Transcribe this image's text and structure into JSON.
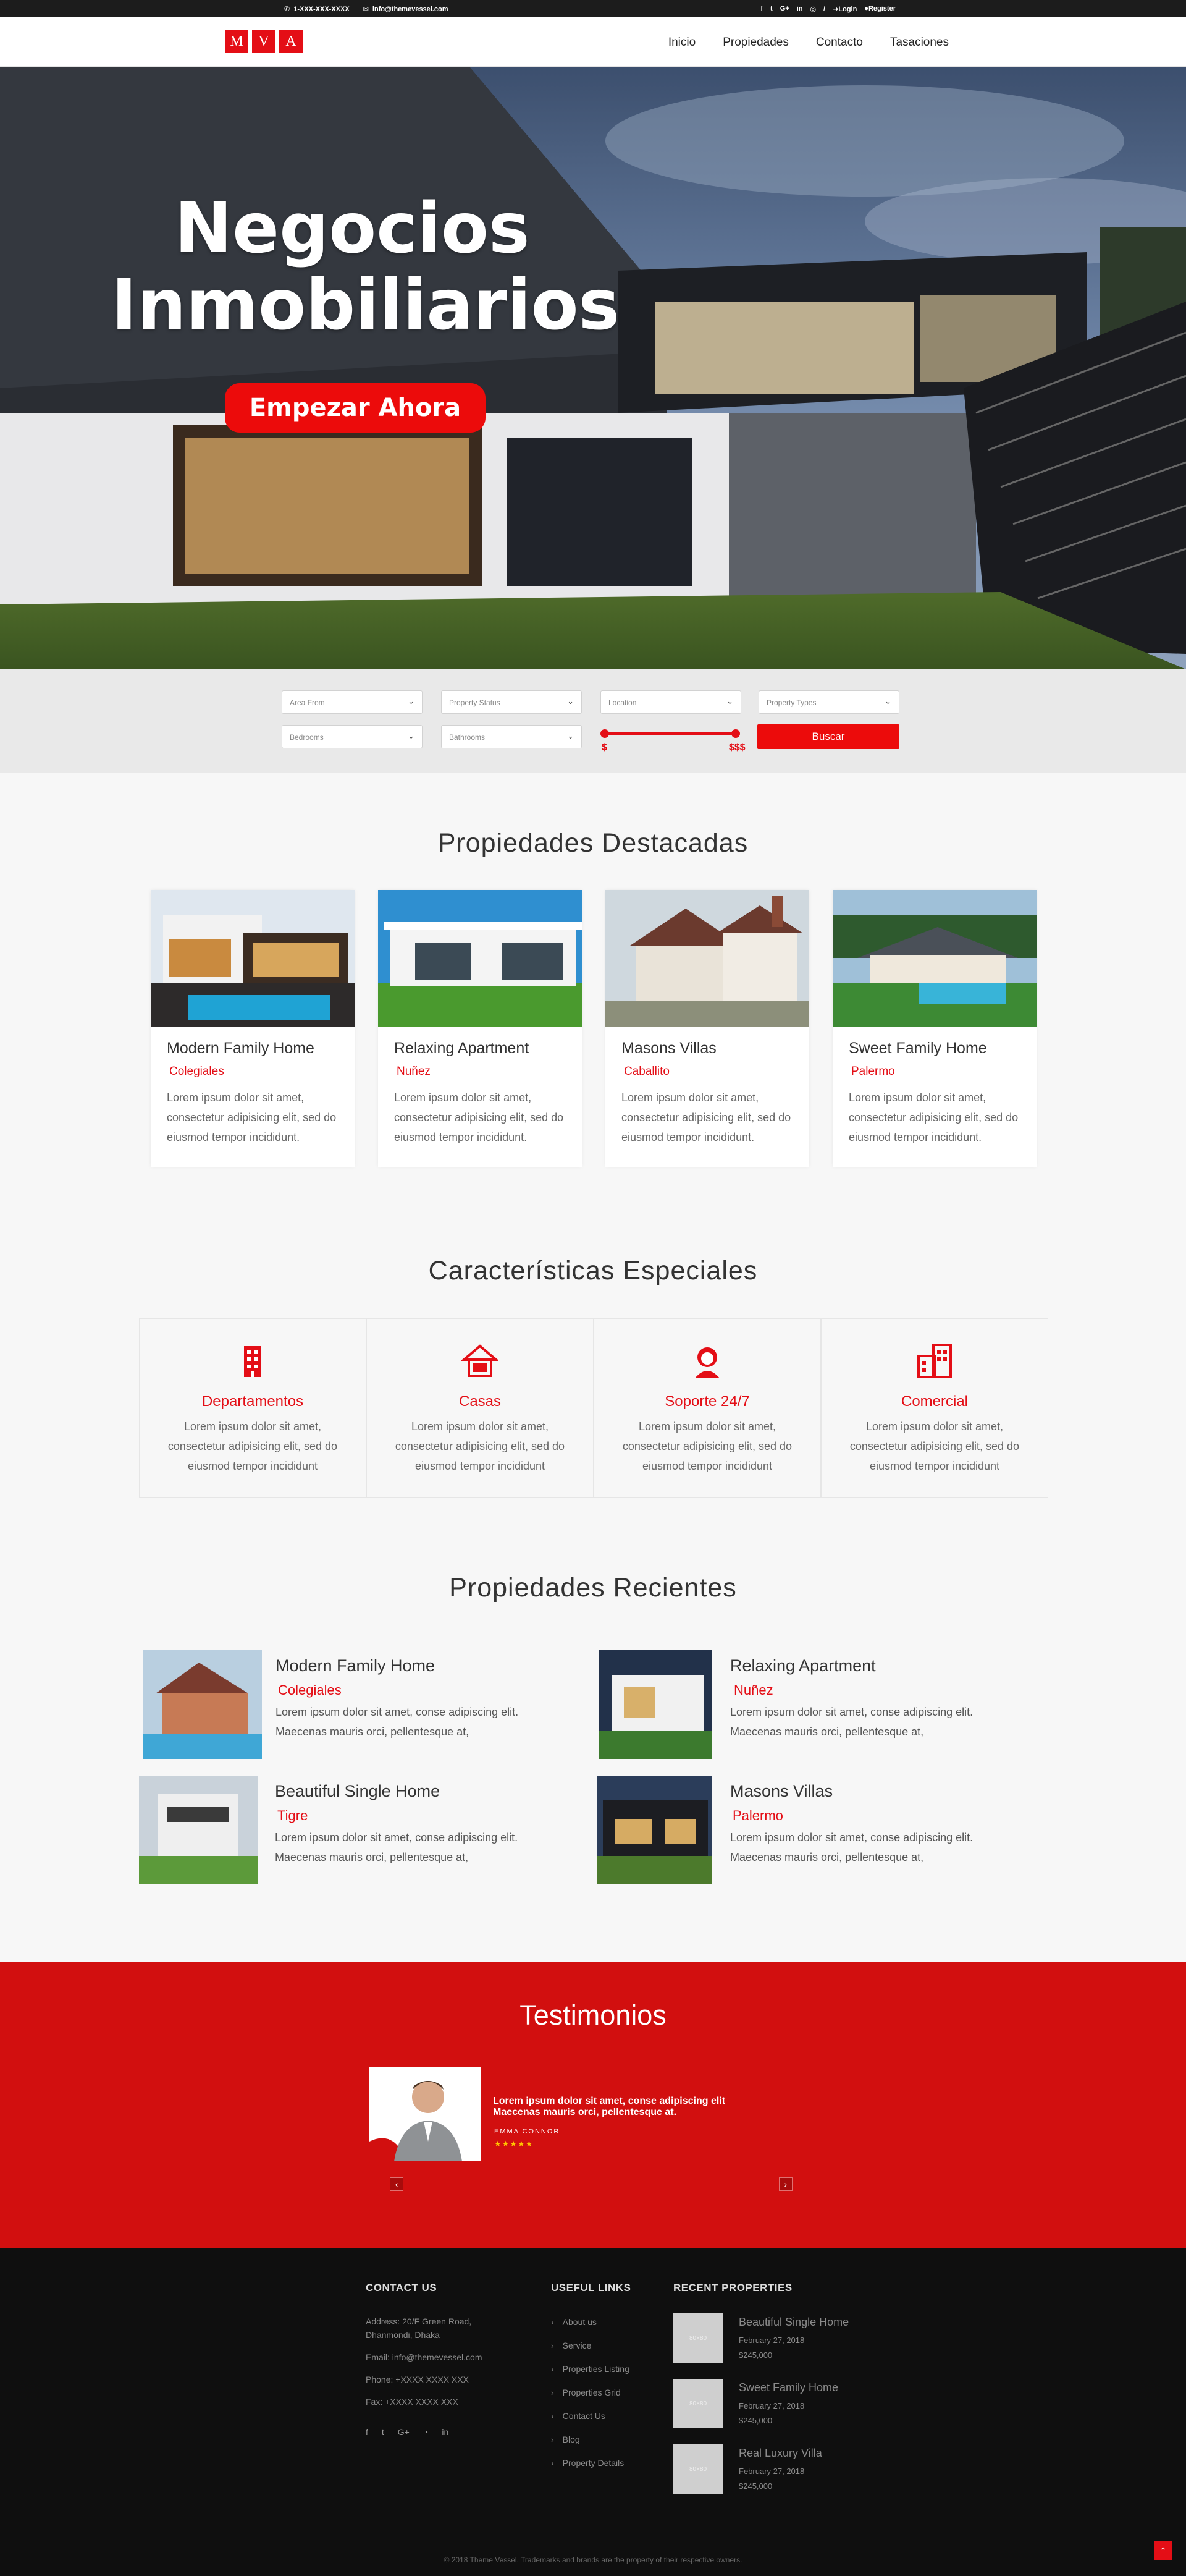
{
  "topbar": {
    "phone": "1-XXX-XXX-XXXX",
    "email": "info@themevessel.com",
    "social_icons": [
      "facebook-icon",
      "twitter-icon",
      "google-plus-icon",
      "linkedin-icon",
      "instagram-icon"
    ],
    "separator": "/",
    "login": "Login",
    "register": "Register"
  },
  "logo": {
    "letters": [
      "M",
      "V",
      "A"
    ]
  },
  "nav": {
    "items": [
      "Inicio",
      "Propiedades",
      "Contacto",
      "Tasaciones"
    ]
  },
  "hero": {
    "title_line1": "Negocios",
    "title_line2": "Inmobiliarios",
    "cta": "Empezar Ahora"
  },
  "search": {
    "area_from": "Area From",
    "property_status": "Property Status",
    "location": "Location",
    "property_types": "Property Types",
    "bedrooms": "Bedrooms",
    "bathrooms": "Bathrooms",
    "price_min_label": "$",
    "price_max_label": "$$$",
    "button": "Buscar"
  },
  "featured": {
    "title": "Propiedades Destacadas",
    "items": [
      {
        "title": "Modern Family Home",
        "location": "Colegiales",
        "desc": "Lorem ipsum dolor sit amet, consectetur adipisicing elit, sed do eiusmod tempor incididunt."
      },
      {
        "title": "Relaxing Apartment",
        "location": "Nuñez",
        "desc": "Lorem ipsum dolor sit amet, consectetur adipisicing elit, sed do eiusmod tempor incididunt."
      },
      {
        "title": "Masons Villas",
        "location": "Caballito",
        "desc": "Lorem ipsum dolor sit amet, consectetur adipisicing elit, sed do eiusmod tempor incididunt."
      },
      {
        "title": "Sweet Family Home",
        "location": "Palermo",
        "desc": "Lorem ipsum dolor sit amet, consectetur adipisicing elit, sed do eiusmod tempor incididunt."
      }
    ]
  },
  "features": {
    "title": "Características Especiales",
    "items": [
      {
        "icon": "building-icon",
        "title": "Departamentos",
        "desc": "Lorem ipsum dolor sit amet, consectetur adipisicing elit, sed do eiusmod tempor incididunt"
      },
      {
        "icon": "house-icon",
        "title": "Casas",
        "desc": "Lorem ipsum dolor sit amet, consectetur adipisicing elit, sed do eiusmod tempor incididunt"
      },
      {
        "icon": "support-agent-icon",
        "title": "Soporte 24/7",
        "desc": "Lorem ipsum dolor sit amet, consectetur adipisicing elit, sed do eiusmod tempor incididunt"
      },
      {
        "icon": "office-building-icon",
        "title": "Comercial",
        "desc": "Lorem ipsum dolor sit amet, consectetur adipisicing elit, sed do eiusmod tempor incididunt"
      }
    ]
  },
  "recent": {
    "title": "Propiedades Recientes",
    "items": [
      {
        "title": "Modern Family Home",
        "location": "Colegiales",
        "desc": "Lorem ipsum dolor sit amet, conse adipiscing elit. Maecenas mauris orci, pellentesque at,"
      },
      {
        "title": "Relaxing Apartment",
        "location": "Nuñez",
        "desc": "Lorem ipsum dolor sit amet, conse adipiscing elit. Maecenas mauris orci, pellentesque at,"
      },
      {
        "title": "Beautiful Single Home",
        "location": "Tigre",
        "desc": "Lorem ipsum dolor sit amet, conse adipiscing elit. Maecenas mauris orci, pellentesque at,"
      },
      {
        "title": "Masons Villas",
        "location": "Palermo",
        "desc": "Lorem ipsum dolor sit amet, conse adipiscing elit. Maecenas mauris orci, pellentesque at,"
      }
    ]
  },
  "testimonials": {
    "title": "Testimonios",
    "quote": "Lorem ipsum dolor sit amet, conse adipiscing elit Maecenas mauris orci, pellentesque at.",
    "name": "EMMA CONNOR",
    "stars": "★★★★★",
    "prev": "‹",
    "next": "›"
  },
  "footer": {
    "contact_title": "CONTACT US",
    "address": "Address: 20/F Green Road, Dhanmondi, Dhaka",
    "email": "Email: info@themevessel.com",
    "phone": "Phone: +XXXX XXXX XXX",
    "fax": "Fax: +XXXX XXXX XXX",
    "links_title": "USEFUL LINKS",
    "links": [
      "About us",
      "Service",
      "Properties Listing",
      "Properties Grid",
      "Contact Us",
      "Blog",
      "Property Details"
    ],
    "recent_title": "RECENT PROPERTIES",
    "recent": [
      {
        "title": "Beautiful Single Home",
        "date": "February 27, 2018",
        "price": "$245,000",
        "thumb": "80×80"
      },
      {
        "title": "Sweet Family Home",
        "date": "February 27, 2018",
        "price": "$245,000",
        "thumb": "80×80"
      },
      {
        "title": "Real Luxury Villa",
        "date": "February 27, 2018",
        "price": "$245,000",
        "thumb": "80×80"
      }
    ],
    "copyright": "© 2018 Theme Vessel. Trademarks and brands are the property of their respective owners."
  },
  "colors": {
    "accent": "#e40e16",
    "testimonial_bg": "#d20f0f",
    "footer_bg": "#0f0f0f"
  }
}
